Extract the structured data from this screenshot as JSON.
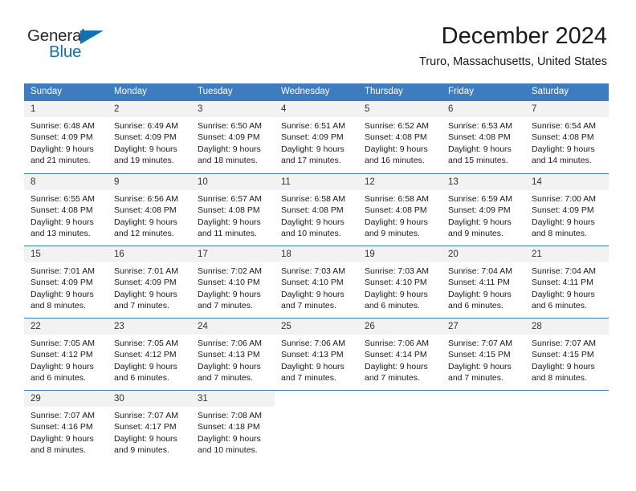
{
  "brand": {
    "name_part1": "General",
    "name_part2": "Blue",
    "accent_color": "#1271b5"
  },
  "header": {
    "month_title": "December 2024",
    "location": "Truro, Massachusetts, United States"
  },
  "theme": {
    "header_row_color": "#3d7dbf",
    "date_band_color": "#f2f2f2"
  },
  "weekday_headers": [
    "Sunday",
    "Monday",
    "Tuesday",
    "Wednesday",
    "Thursday",
    "Friday",
    "Saturday"
  ],
  "weeks": [
    [
      {
        "day": "1",
        "sunrise": "Sunrise: 6:48 AM",
        "sunset": "Sunset: 4:09 PM",
        "daylight1": "Daylight: 9 hours",
        "daylight2": "and 21 minutes."
      },
      {
        "day": "2",
        "sunrise": "Sunrise: 6:49 AM",
        "sunset": "Sunset: 4:09 PM",
        "daylight1": "Daylight: 9 hours",
        "daylight2": "and 19 minutes."
      },
      {
        "day": "3",
        "sunrise": "Sunrise: 6:50 AM",
        "sunset": "Sunset: 4:09 PM",
        "daylight1": "Daylight: 9 hours",
        "daylight2": "and 18 minutes."
      },
      {
        "day": "4",
        "sunrise": "Sunrise: 6:51 AM",
        "sunset": "Sunset: 4:09 PM",
        "daylight1": "Daylight: 9 hours",
        "daylight2": "and 17 minutes."
      },
      {
        "day": "5",
        "sunrise": "Sunrise: 6:52 AM",
        "sunset": "Sunset: 4:08 PM",
        "daylight1": "Daylight: 9 hours",
        "daylight2": "and 16 minutes."
      },
      {
        "day": "6",
        "sunrise": "Sunrise: 6:53 AM",
        "sunset": "Sunset: 4:08 PM",
        "daylight1": "Daylight: 9 hours",
        "daylight2": "and 15 minutes."
      },
      {
        "day": "7",
        "sunrise": "Sunrise: 6:54 AM",
        "sunset": "Sunset: 4:08 PM",
        "daylight1": "Daylight: 9 hours",
        "daylight2": "and 14 minutes."
      }
    ],
    [
      {
        "day": "8",
        "sunrise": "Sunrise: 6:55 AM",
        "sunset": "Sunset: 4:08 PM",
        "daylight1": "Daylight: 9 hours",
        "daylight2": "and 13 minutes."
      },
      {
        "day": "9",
        "sunrise": "Sunrise: 6:56 AM",
        "sunset": "Sunset: 4:08 PM",
        "daylight1": "Daylight: 9 hours",
        "daylight2": "and 12 minutes."
      },
      {
        "day": "10",
        "sunrise": "Sunrise: 6:57 AM",
        "sunset": "Sunset: 4:08 PM",
        "daylight1": "Daylight: 9 hours",
        "daylight2": "and 11 minutes."
      },
      {
        "day": "11",
        "sunrise": "Sunrise: 6:58 AM",
        "sunset": "Sunset: 4:08 PM",
        "daylight1": "Daylight: 9 hours",
        "daylight2": "and 10 minutes."
      },
      {
        "day": "12",
        "sunrise": "Sunrise: 6:58 AM",
        "sunset": "Sunset: 4:08 PM",
        "daylight1": "Daylight: 9 hours",
        "daylight2": "and 9 minutes."
      },
      {
        "day": "13",
        "sunrise": "Sunrise: 6:59 AM",
        "sunset": "Sunset: 4:09 PM",
        "daylight1": "Daylight: 9 hours",
        "daylight2": "and 9 minutes."
      },
      {
        "day": "14",
        "sunrise": "Sunrise: 7:00 AM",
        "sunset": "Sunset: 4:09 PM",
        "daylight1": "Daylight: 9 hours",
        "daylight2": "and 8 minutes."
      }
    ],
    [
      {
        "day": "15",
        "sunrise": "Sunrise: 7:01 AM",
        "sunset": "Sunset: 4:09 PM",
        "daylight1": "Daylight: 9 hours",
        "daylight2": "and 8 minutes."
      },
      {
        "day": "16",
        "sunrise": "Sunrise: 7:01 AM",
        "sunset": "Sunset: 4:09 PM",
        "daylight1": "Daylight: 9 hours",
        "daylight2": "and 7 minutes."
      },
      {
        "day": "17",
        "sunrise": "Sunrise: 7:02 AM",
        "sunset": "Sunset: 4:10 PM",
        "daylight1": "Daylight: 9 hours",
        "daylight2": "and 7 minutes."
      },
      {
        "day": "18",
        "sunrise": "Sunrise: 7:03 AM",
        "sunset": "Sunset: 4:10 PM",
        "daylight1": "Daylight: 9 hours",
        "daylight2": "and 7 minutes."
      },
      {
        "day": "19",
        "sunrise": "Sunrise: 7:03 AM",
        "sunset": "Sunset: 4:10 PM",
        "daylight1": "Daylight: 9 hours",
        "daylight2": "and 6 minutes."
      },
      {
        "day": "20",
        "sunrise": "Sunrise: 7:04 AM",
        "sunset": "Sunset: 4:11 PM",
        "daylight1": "Daylight: 9 hours",
        "daylight2": "and 6 minutes."
      },
      {
        "day": "21",
        "sunrise": "Sunrise: 7:04 AM",
        "sunset": "Sunset: 4:11 PM",
        "daylight1": "Daylight: 9 hours",
        "daylight2": "and 6 minutes."
      }
    ],
    [
      {
        "day": "22",
        "sunrise": "Sunrise: 7:05 AM",
        "sunset": "Sunset: 4:12 PM",
        "daylight1": "Daylight: 9 hours",
        "daylight2": "and 6 minutes."
      },
      {
        "day": "23",
        "sunrise": "Sunrise: 7:05 AM",
        "sunset": "Sunset: 4:12 PM",
        "daylight1": "Daylight: 9 hours",
        "daylight2": "and 6 minutes."
      },
      {
        "day": "24",
        "sunrise": "Sunrise: 7:06 AM",
        "sunset": "Sunset: 4:13 PM",
        "daylight1": "Daylight: 9 hours",
        "daylight2": "and 7 minutes."
      },
      {
        "day": "25",
        "sunrise": "Sunrise: 7:06 AM",
        "sunset": "Sunset: 4:13 PM",
        "daylight1": "Daylight: 9 hours",
        "daylight2": "and 7 minutes."
      },
      {
        "day": "26",
        "sunrise": "Sunrise: 7:06 AM",
        "sunset": "Sunset: 4:14 PM",
        "daylight1": "Daylight: 9 hours",
        "daylight2": "and 7 minutes."
      },
      {
        "day": "27",
        "sunrise": "Sunrise: 7:07 AM",
        "sunset": "Sunset: 4:15 PM",
        "daylight1": "Daylight: 9 hours",
        "daylight2": "and 7 minutes."
      },
      {
        "day": "28",
        "sunrise": "Sunrise: 7:07 AM",
        "sunset": "Sunset: 4:15 PM",
        "daylight1": "Daylight: 9 hours",
        "daylight2": "and 8 minutes."
      }
    ],
    [
      {
        "day": "29",
        "sunrise": "Sunrise: 7:07 AM",
        "sunset": "Sunset: 4:16 PM",
        "daylight1": "Daylight: 9 hours",
        "daylight2": "and 8 minutes."
      },
      {
        "day": "30",
        "sunrise": "Sunrise: 7:07 AM",
        "sunset": "Sunset: 4:17 PM",
        "daylight1": "Daylight: 9 hours",
        "daylight2": "and 9 minutes."
      },
      {
        "day": "31",
        "sunrise": "Sunrise: 7:08 AM",
        "sunset": "Sunset: 4:18 PM",
        "daylight1": "Daylight: 9 hours",
        "daylight2": "and 10 minutes."
      },
      {
        "day": "",
        "sunrise": "",
        "sunset": "",
        "daylight1": "",
        "daylight2": ""
      },
      {
        "day": "",
        "sunrise": "",
        "sunset": "",
        "daylight1": "",
        "daylight2": ""
      },
      {
        "day": "",
        "sunrise": "",
        "sunset": "",
        "daylight1": "",
        "daylight2": ""
      },
      {
        "day": "",
        "sunrise": "",
        "sunset": "",
        "daylight1": "",
        "daylight2": ""
      }
    ]
  ]
}
